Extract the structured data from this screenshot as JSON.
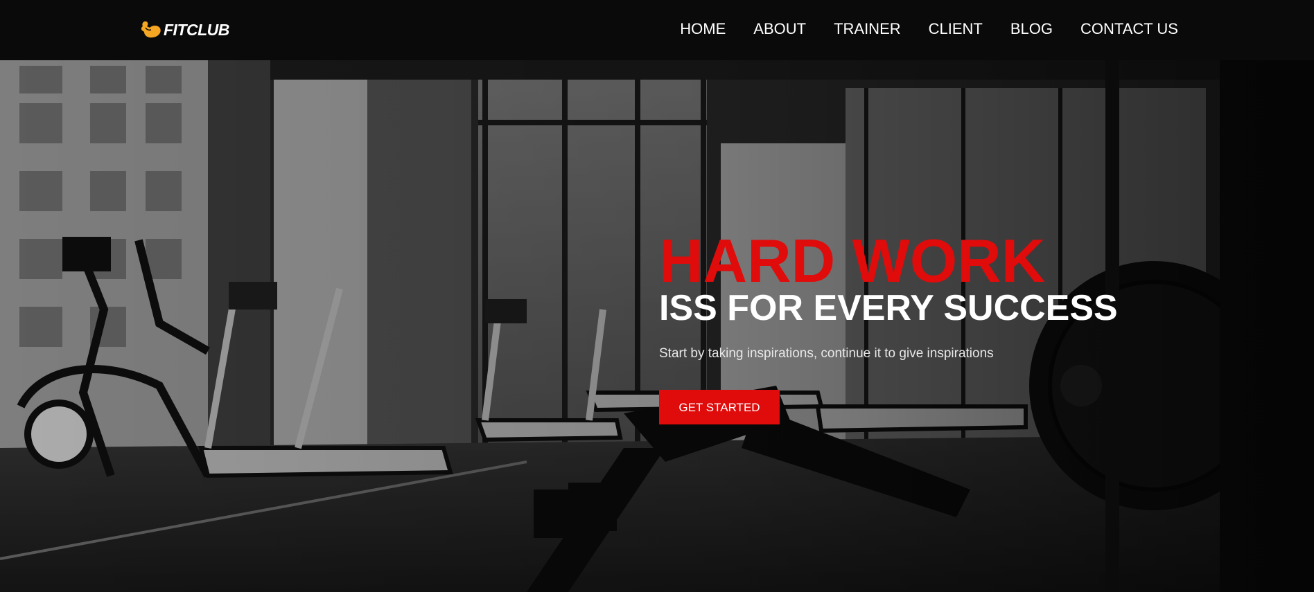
{
  "brand": {
    "name": "FITCLUB",
    "icon": "flexing-arm-icon",
    "accent": "#f5a623"
  },
  "nav": {
    "items": [
      {
        "label": "HOME"
      },
      {
        "label": "ABOUT"
      },
      {
        "label": "TRAINER"
      },
      {
        "label": "CLIENT"
      },
      {
        "label": "BLOG"
      },
      {
        "label": "CONTACT US"
      }
    ]
  },
  "hero": {
    "headline": "HARD WORK",
    "subheadline": "ISS FOR EVERY SUCCESS",
    "tagline": "Start by taking inspirations, continue it to give inspirations",
    "cta_label": "GET STARTED",
    "headline_color": "#e00b0b",
    "background": "grayscale-gym-photo"
  }
}
